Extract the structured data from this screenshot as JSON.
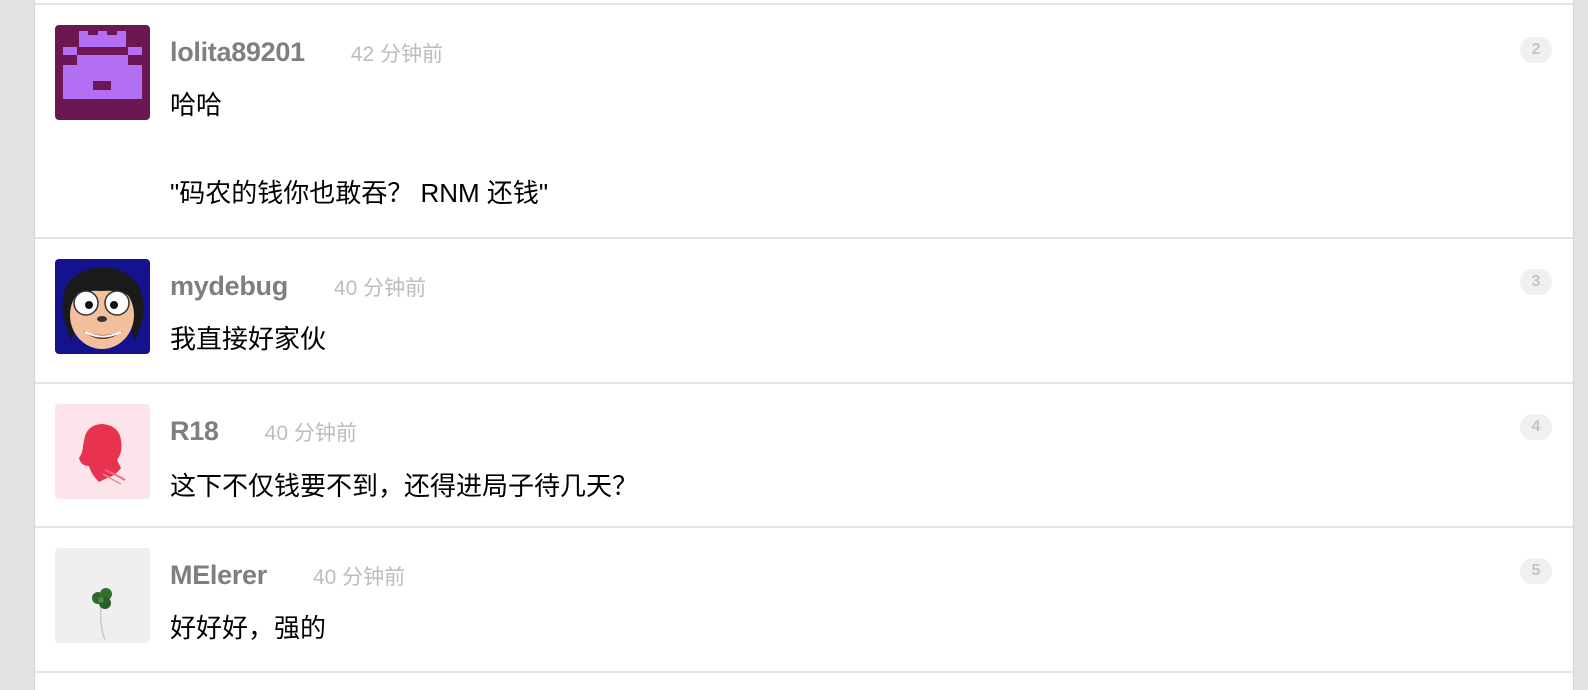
{
  "replies": [
    {
      "username": "lolita89201",
      "time_ago": "42 分钟前",
      "content": "哈哈\n\n\"码农的钱你也敢吞？ RNM 还钱\"",
      "floor": "2",
      "avatar_icon": "purple-pixel-avatar-icon",
      "avatar_colors": [
        "#6b1a54",
        "#b06ff2"
      ]
    },
    {
      "username": "mydebug",
      "time_ago": "40 分钟前",
      "content": "我直接好家伙",
      "floor": "3",
      "avatar_icon": "cartoon-face-avatar-icon",
      "avatar_colors": [
        "#151396",
        "#f6c6a2"
      ]
    },
    {
      "username": "R18",
      "time_ago": "40 分钟前",
      "content": "这下不仅钱要不到，还得进局子待几天？",
      "floor": "4",
      "avatar_icon": "red-silhouette-avatar-icon",
      "avatar_colors": [
        "#fde4ea",
        "#e83352"
      ]
    },
    {
      "username": "MElerer",
      "time_ago": "40 分钟前",
      "content": "好好好，强的",
      "floor": "5",
      "avatar_icon": "clover-avatar-icon",
      "avatar_colors": [
        "#efefef",
        "#2f6b2f"
      ]
    }
  ]
}
